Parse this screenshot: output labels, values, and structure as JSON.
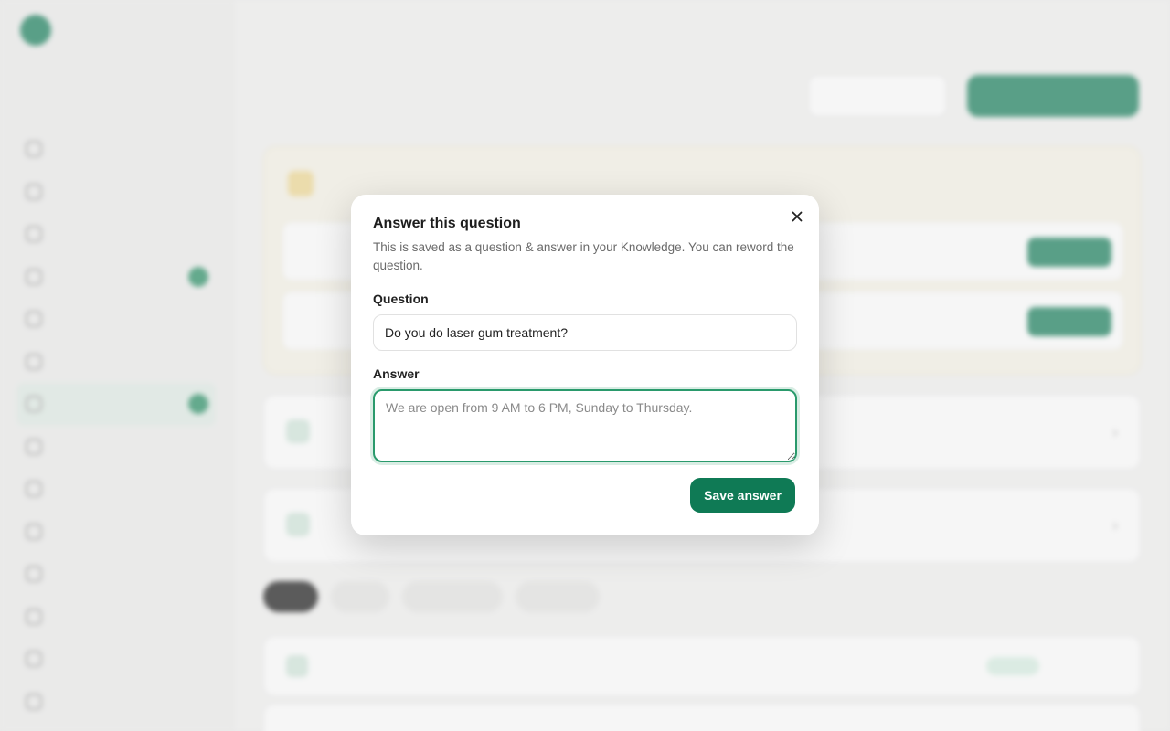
{
  "colors": {
    "brand": "#0f7a55",
    "focus_ring": "#2a9a6c",
    "background": "#f1f1f0"
  },
  "modal": {
    "title": "Answer this question",
    "description": "This is saved as a question & answer in your Knowledge. You can reword the question.",
    "close_icon": "close-icon",
    "question_label": "Question",
    "question_value": "Do you do laser gum treatment?",
    "answer_label": "Answer",
    "answer_value": "",
    "answer_placeholder": "We are open from 9 AM to 6 PM, Sunday to Thursday.",
    "save_label": "Save answer"
  }
}
